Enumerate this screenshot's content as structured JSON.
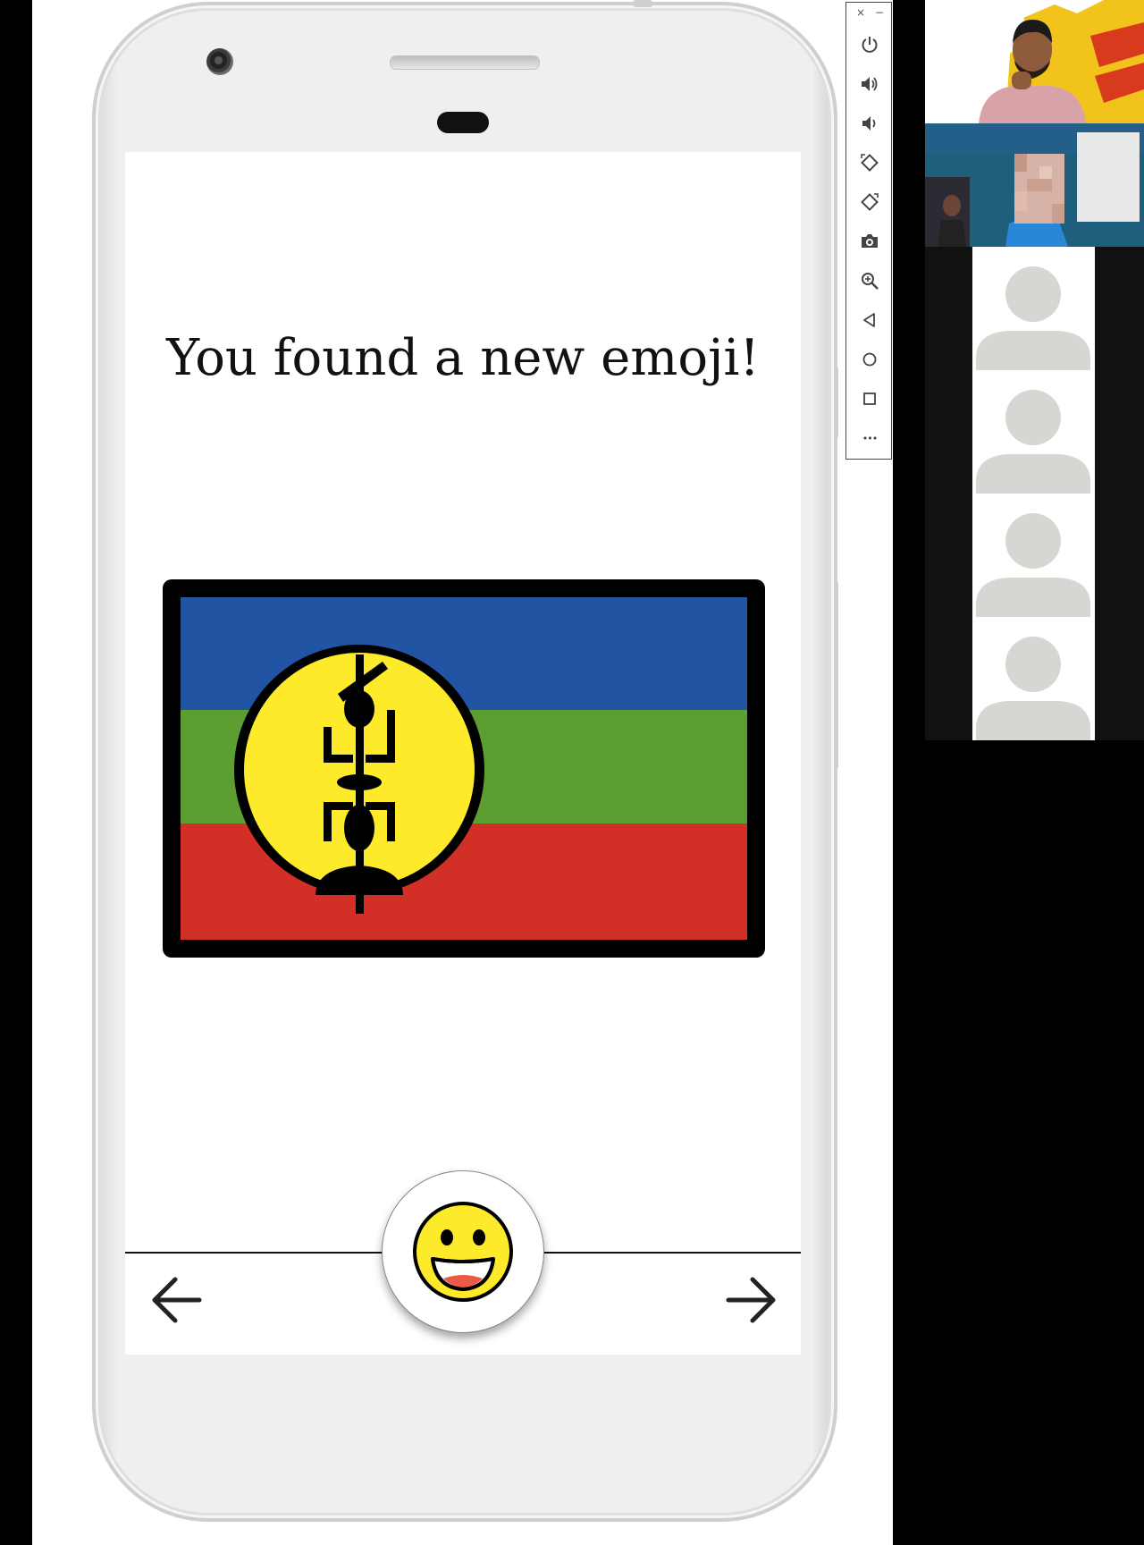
{
  "screen": {
    "title": "You found a new emoji!"
  },
  "emoji_flag": {
    "icon": "new-caledonia-flag",
    "colors": {
      "blue": "#2254a4",
      "green": "#5c9e31",
      "red": "#d22f27",
      "yellow": "#fcea2b",
      "outline": "#000000"
    }
  },
  "navigation": {
    "back_icon": "arrow-left-icon",
    "next_icon": "arrow-right-icon",
    "center_icon": "grinning-face-icon"
  },
  "emulator_toolbar": {
    "items": [
      "power-icon",
      "volume-up-icon",
      "volume-down-icon",
      "rotate-left-icon",
      "rotate-right-icon",
      "camera-icon",
      "zoom-icon",
      "back-icon",
      "home-icon",
      "overview-icon",
      "more-icon"
    ],
    "close_glyph": "×",
    "minimize_glyph": "−",
    "more_glyph": "•••"
  },
  "video_gallery": {
    "tiles": [
      "participant-video-1",
      "participant-video-2",
      "participant-avatar-3",
      "participant-avatar-4",
      "participant-avatar-5",
      "participant-avatar-6"
    ]
  }
}
